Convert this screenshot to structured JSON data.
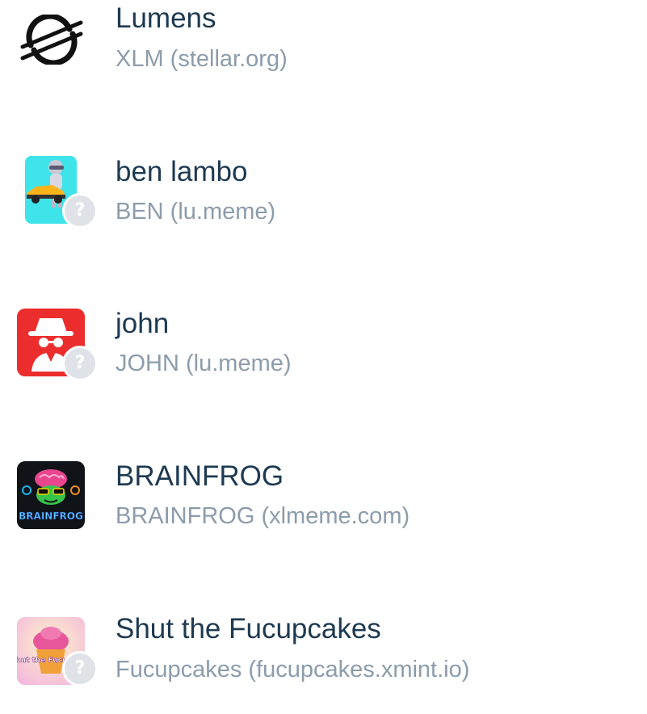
{
  "assets": [
    {
      "name": "Lumens",
      "subtitle": "XLM (stellar.org)",
      "icon": "stellar-logo",
      "badge": null
    },
    {
      "name": "ben lambo",
      "subtitle": "BEN (lu.meme)",
      "icon": "ben-lambo-token-image",
      "badge": "?"
    },
    {
      "name": "john",
      "subtitle": "JOHN (lu.meme)",
      "icon": "john-token-image",
      "badge": "?"
    },
    {
      "name": "BRAINFROG",
      "subtitle": "BRAINFROG (xlmeme.com)",
      "icon": "brainfrog-token-image",
      "icon_text": "BRAINFROG",
      "badge": null
    },
    {
      "name": "Shut the Fucupcakes",
      "subtitle": "Fucupcakes (fucupcakes.xmint.io)",
      "icon": "fucupcakes-token-image",
      "icon_text": "Shut the Fucupca",
      "badge": "?"
    }
  ],
  "colors": {
    "name_text": "#1e3a52",
    "subtitle_text": "#8c9cab",
    "badge_bg": "#dfe3e8",
    "ben_icon_bg": "#3fe3ea",
    "john_icon_bg": "#ec2d2d",
    "brainfrog_icon_bg": "#101418",
    "fucupcakes_icon_bg": "#f8d9e8"
  }
}
